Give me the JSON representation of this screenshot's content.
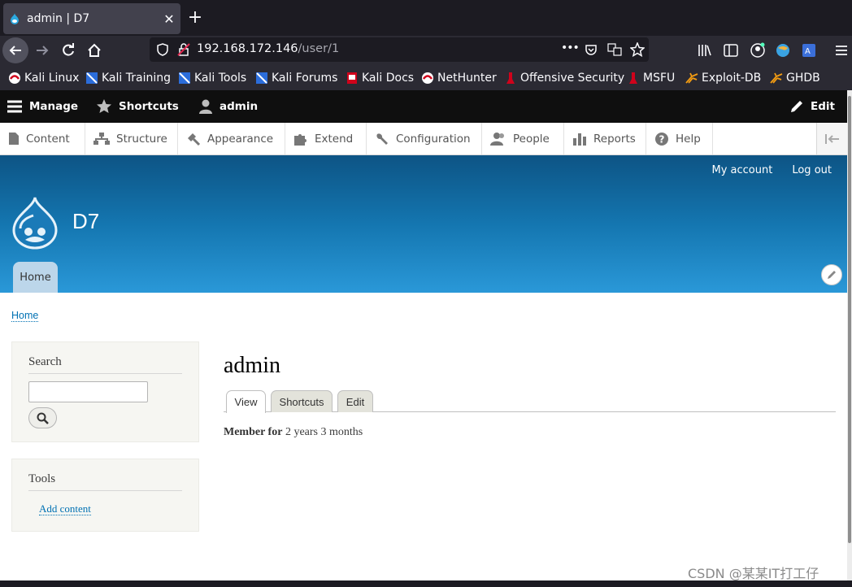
{
  "browser": {
    "tab_title": "admin | D7",
    "tab_close": "✕",
    "new_tab": "+",
    "url_host": "192.168.172.146",
    "url_path": "/user/1",
    "url_more": "•••",
    "bookmarks": [
      {
        "label": "Kali Linux",
        "icon": "kali-dragon-icon"
      },
      {
        "label": "Kali Training",
        "icon": "kali-training-icon"
      },
      {
        "label": "Kali Tools",
        "icon": "kali-tools-icon"
      },
      {
        "label": "Kali Forums",
        "icon": "kali-forums-icon"
      },
      {
        "label": "Kali Docs",
        "icon": "kali-docs-icon"
      },
      {
        "label": "NetHunter",
        "icon": "nethunter-icon"
      },
      {
        "label": "Offensive Security",
        "icon": "offsec-icon"
      },
      {
        "label": "MSFU",
        "icon": "msfu-icon"
      },
      {
        "label": "Exploit-DB",
        "icon": "exploit-db-icon"
      },
      {
        "label": "GHDB",
        "icon": "ghdb-icon"
      }
    ]
  },
  "toolbar": {
    "manage": "Manage",
    "shortcuts": "Shortcuts",
    "user": "admin",
    "edit": "Edit"
  },
  "tray": {
    "items": [
      "Content",
      "Structure",
      "Appearance",
      "Extend",
      "Configuration",
      "People",
      "Reports",
      "Help"
    ]
  },
  "header": {
    "my_account": "My account",
    "log_out": "Log out",
    "site_name": "D7",
    "home_tab": "Home"
  },
  "breadcrumb": "Home",
  "sidebar": {
    "search_title": "Search",
    "tools_title": "Tools",
    "add_content": "Add content"
  },
  "main": {
    "title": "admin",
    "tabs": [
      "View",
      "Shortcuts",
      "Edit"
    ],
    "member_label": "Member for",
    "member_value": "2 years 3 months"
  },
  "watermark": "CSDN @某某IT打工仔",
  "colors": {
    "header_top": "#0d5485",
    "header_bottom": "#2a98d8",
    "link": "#0071b3",
    "toolbar_bg": "#0f0f0f"
  }
}
